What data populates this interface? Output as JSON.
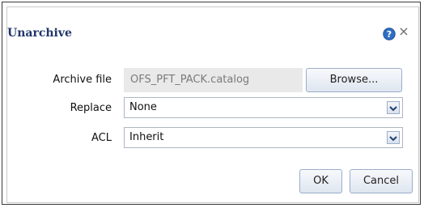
{
  "dialog": {
    "title": "Unarchive",
    "close_glyph": "×"
  },
  "form": {
    "archive_file": {
      "label": "Archive file",
      "value": "OFS_PFT_PACK.catalog",
      "browse_label": "Browse..."
    },
    "replace": {
      "label": "Replace",
      "value": "None"
    },
    "acl": {
      "label": "ACL",
      "value": "Inherit"
    }
  },
  "actions": {
    "ok_label": "OK",
    "cancel_label": "Cancel"
  },
  "icons": {
    "help": "help-icon",
    "close": "close-icon",
    "dropdown": "chevron-down-icon"
  },
  "colors": {
    "title": "#20366b",
    "help_icon": "#2f6fc4"
  }
}
